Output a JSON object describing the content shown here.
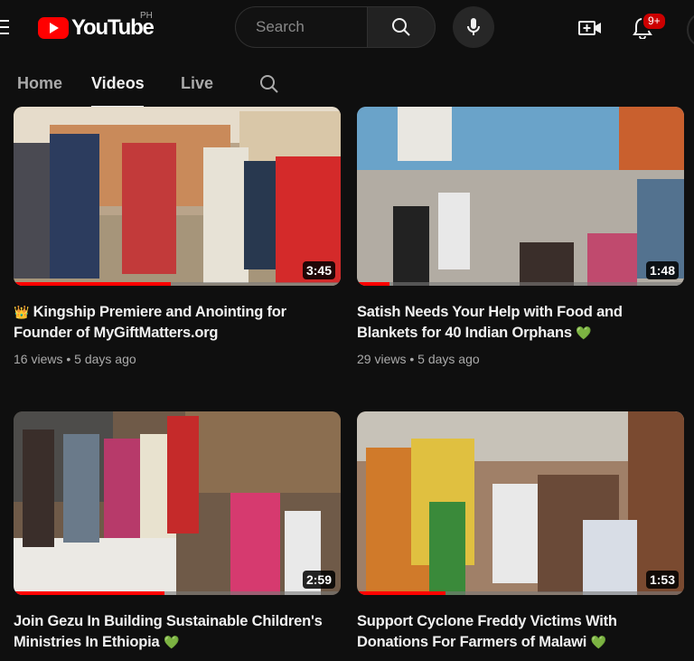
{
  "app": {
    "logo_text": "YouTube",
    "country_code": "PH",
    "brand_color": "#ff0000"
  },
  "search": {
    "placeholder": "Search"
  },
  "notifications": {
    "badge": "9+"
  },
  "tabs": [
    {
      "label": "Home",
      "active": false
    },
    {
      "label": "Videos",
      "active": true
    },
    {
      "label": "Live",
      "active": false
    }
  ],
  "videos": [
    {
      "prefix": "👑",
      "title": "Kingship Premiere and Anointing for Founder of MyGiftMatters.org",
      "suffix": "",
      "duration": "3:45",
      "views": "16 views",
      "age": "5 days ago",
      "watched_fraction": 0.48
    },
    {
      "prefix": "",
      "title": "Satish Needs Your Help with Food and Blankets for 40 Indian Orphans",
      "suffix": "💚",
      "duration": "1:48",
      "views": "29 views",
      "age": "5 days ago",
      "watched_fraction": 0.1
    },
    {
      "prefix": "",
      "title": "Join Gezu In Building Sustainable Children's Ministries In Ethiopia",
      "suffix": "💚",
      "duration": "2:59",
      "views": "",
      "age": "",
      "watched_fraction": 0.46
    },
    {
      "prefix": "",
      "title": "Support Cyclone Freddy Victims With Donations For Farmers of Malawi",
      "suffix": "💚",
      "duration": "1:53",
      "views": "",
      "age": "",
      "watched_fraction": 0.27
    }
  ],
  "icons": {
    "menu": "menu-icon",
    "search": "search-icon",
    "mic": "mic-icon",
    "create": "create-video-icon",
    "bell": "bell-icon"
  }
}
